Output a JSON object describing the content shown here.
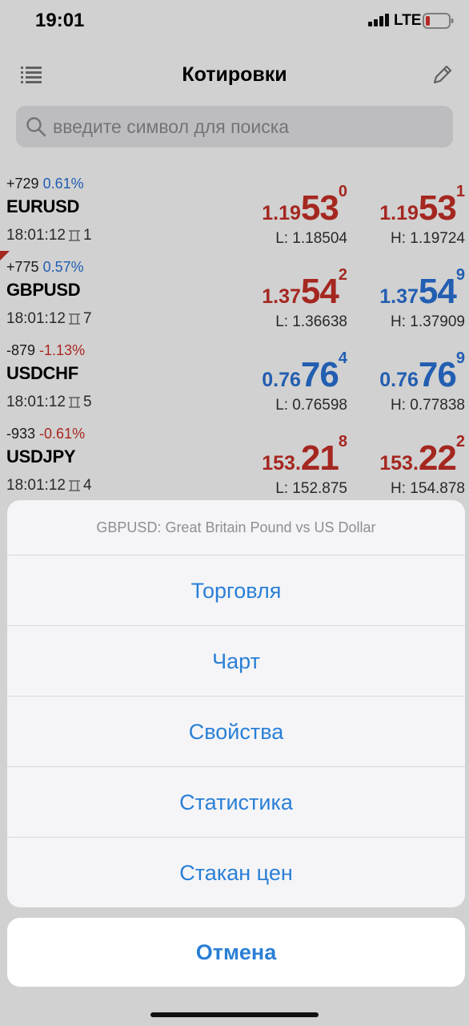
{
  "status_bar": {
    "time": "19:01",
    "network": "LTE"
  },
  "nav": {
    "title": "Котировки"
  },
  "search": {
    "placeholder": "введите символ для поиска"
  },
  "colors": {
    "up": "#2a73d8",
    "down": "#c93028",
    "accent": "#2a7fd6"
  },
  "quotes": [
    {
      "change_points": "+729",
      "change_percent": "0.61%",
      "symbol": "EURUSD",
      "time": "18:01:12",
      "spread": "1",
      "bid": {
        "prefix": "1.19",
        "big": "53",
        "sup": "0"
      },
      "ask": {
        "prefix": "1.19",
        "big": "53",
        "sup": "1"
      },
      "low": "L: 1.18504",
      "high": "H: 1.19724"
    },
    {
      "change_points": "+775",
      "change_percent": "0.57%",
      "symbol": "GBPUSD",
      "time": "18:01:12",
      "spread": "7",
      "bid": {
        "prefix": "1.37",
        "big": "54",
        "sup": "2"
      },
      "ask": {
        "prefix": "1.37",
        "big": "54",
        "sup": "9"
      },
      "low": "L: 1.36638",
      "high": "H: 1.37909"
    },
    {
      "change_points": "-879",
      "change_percent": "-1.13%",
      "symbol": "USDCHF",
      "time": "18:01:12",
      "spread": "5",
      "bid": {
        "prefix": "0.76",
        "big": "76",
        "sup": "4"
      },
      "ask": {
        "prefix": "0.76",
        "big": "76",
        "sup": "9"
      },
      "low": "L: 0.76598",
      "high": "H: 0.77838"
    },
    {
      "change_points": "-933",
      "change_percent": "-0.61%",
      "symbol": "USDJPY",
      "time": "18:01:12",
      "spread": "4",
      "bid": {
        "prefix": "153.",
        "big": "21",
        "sup": "8"
      },
      "ask": {
        "prefix": "153.",
        "big": "22",
        "sup": "2"
      },
      "low": "L: 152.875",
      "high": "H: 154.878"
    }
  ],
  "action_sheet": {
    "title": "GBPUSD: Great Britain Pound vs US Dollar",
    "items": [
      "Торговля",
      "Чарт",
      "Свойства",
      "Статистика",
      "Стакан цен"
    ],
    "cancel": "Отмена"
  }
}
